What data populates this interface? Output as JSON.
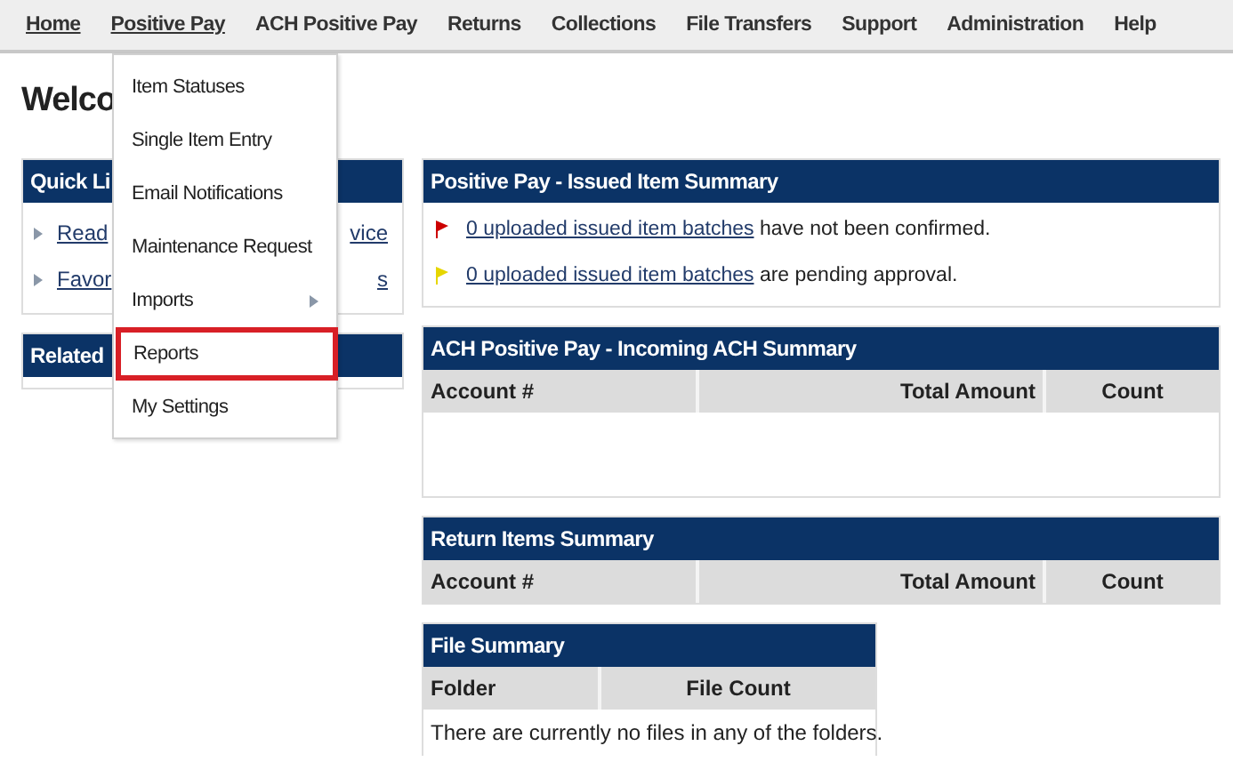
{
  "menu_bar": [
    {
      "label": "Home",
      "underlined": true
    },
    {
      "label": "Positive Pay",
      "underlined": true
    },
    {
      "label": "ACH Positive Pay",
      "underlined": false
    },
    {
      "label": "Returns",
      "underlined": false
    },
    {
      "label": "Collections",
      "underlined": false
    },
    {
      "label": "File Transfers",
      "underlined": false
    },
    {
      "label": "Support",
      "underlined": false
    },
    {
      "label": "Administration",
      "underlined": false
    },
    {
      "label": "Help",
      "underlined": false
    }
  ],
  "dropdown": [
    {
      "label": "Item Statuses",
      "submenu": false,
      "highlighted": false
    },
    {
      "label": "Single Item Entry",
      "submenu": false,
      "highlighted": false
    },
    {
      "label": "Email Notifications",
      "submenu": false,
      "highlighted": false
    },
    {
      "label": "Maintenance Request",
      "submenu": false,
      "highlighted": false
    },
    {
      "label": "Imports",
      "submenu": true,
      "highlighted": false
    },
    {
      "label": "Reports",
      "submenu": false,
      "highlighted": true
    },
    {
      "label": "My Settings",
      "submenu": false,
      "highlighted": false
    }
  ],
  "heading": "Welco",
  "quick_links": {
    "title": "Quick Li",
    "links": [
      {
        "start": "Read",
        "end": "vice"
      },
      {
        "start": "Favor",
        "end": "s"
      }
    ]
  },
  "related": {
    "title": "Related"
  },
  "issued_summary": {
    "title": "Positive Pay - Issued Item Summary",
    "rows": [
      {
        "color": "#cc0000",
        "link": "0 uploaded issued item batches",
        "text": "have not been confirmed."
      },
      {
        "color": "#e6d600",
        "link": "0 uploaded issued item batches",
        "text": "are pending approval."
      }
    ]
  },
  "ach_summary": {
    "title": "ACH Positive Pay - Incoming ACH Summary",
    "columns": [
      "Account #",
      "Total Amount",
      "Count"
    ]
  },
  "return_summary": {
    "title": "Return Items Summary",
    "columns": [
      "Account #",
      "Total Amount",
      "Count"
    ]
  },
  "file_summary": {
    "title": "File Summary",
    "columns": [
      "Folder",
      "File Count"
    ],
    "message": "There are currently no files in any of the folders."
  }
}
